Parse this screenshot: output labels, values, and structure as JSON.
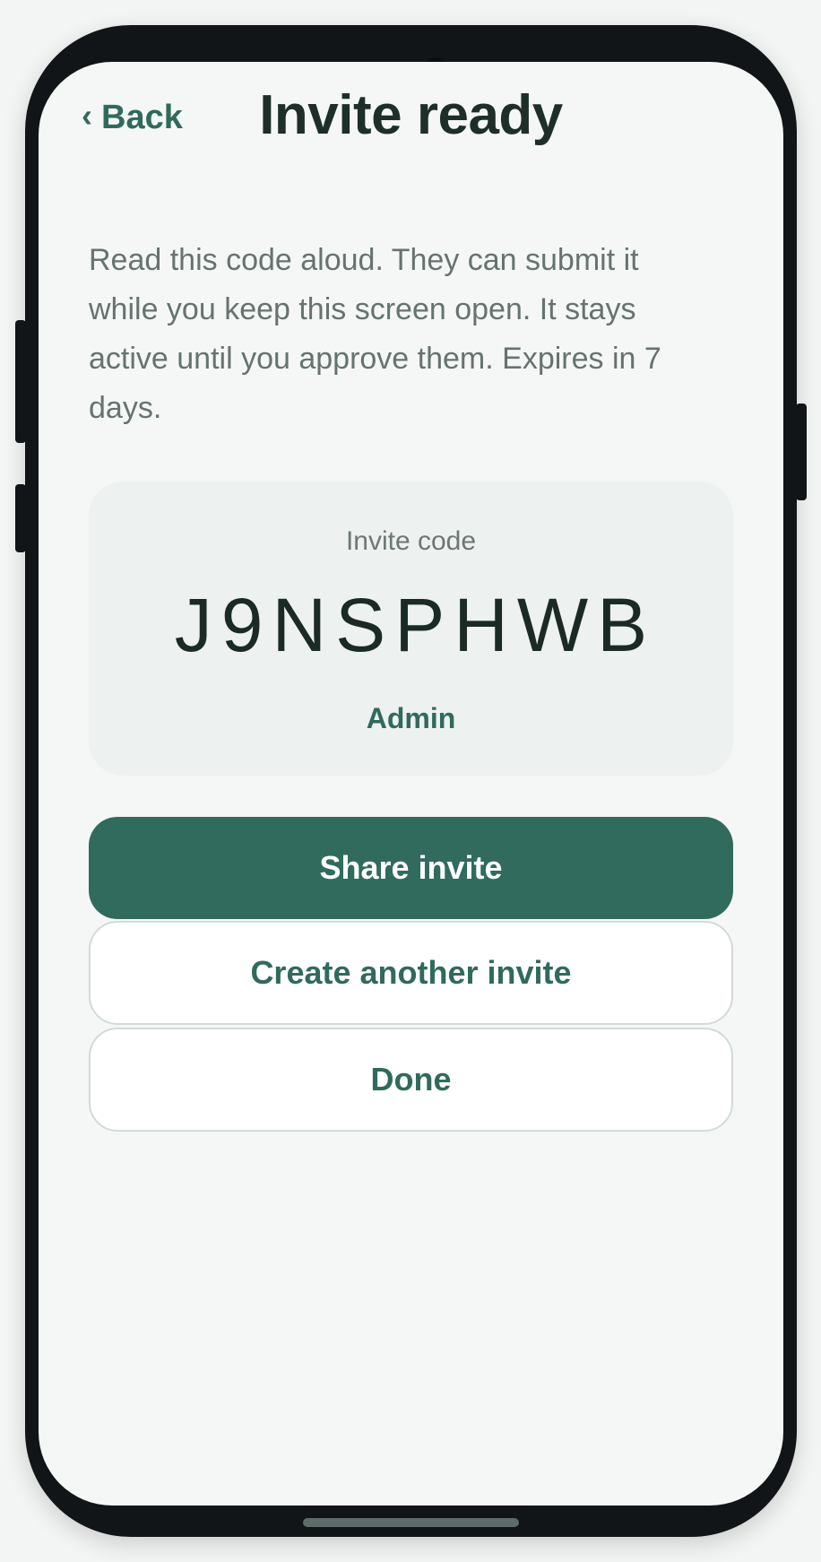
{
  "header": {
    "back_label": "Back",
    "back_chevron": "‹",
    "title": "Invite ready"
  },
  "main": {
    "description": "Read this code aloud. They can submit it while you keep this screen open. It stays active until you approve them. Expires in 7 days.",
    "code_card": {
      "caption": "Invite code",
      "code": "J9NSPHWB",
      "role": "Admin"
    },
    "buttons": {
      "share": "Share invite",
      "create_another": "Create another invite",
      "done": "Done"
    }
  },
  "icons": {
    "back": "chevron-left-icon"
  },
  "colors": {
    "accent": "#306b5d",
    "title_text": "#1e2e29",
    "body_text": "#66736f",
    "card_background": "#edf1f0",
    "screen_background": "#f5f7f6",
    "device_frame": "#111518"
  }
}
